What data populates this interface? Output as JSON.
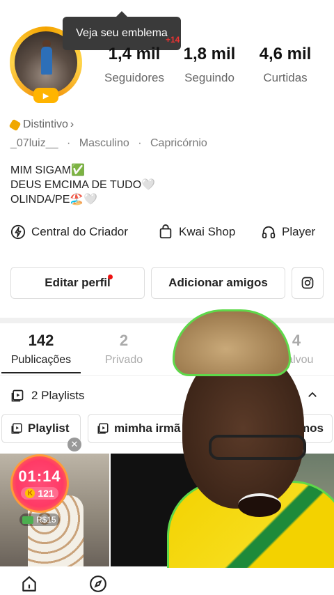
{
  "tooltip": {
    "text": "Veja seu emblema",
    "extra_badge": "+14"
  },
  "stats": [
    {
      "value": "1,4 mil",
      "label": "Seguidores"
    },
    {
      "value": "1,8 mil",
      "label": "Seguindo"
    },
    {
      "value": "4,6 mil",
      "label": "Curtidas"
    }
  ],
  "profile": {
    "distintivo": "Distintivo",
    "distintivo_chevron": "›",
    "username": "_07luiz__",
    "gender": "Masculino",
    "sign": "Capricórnio",
    "separator": "·",
    "bio_lines": [
      "MIM SIGAM✅",
      "DEUS EMCIMA DE TUDO🤍",
      "OLINDA/PE🏖️🤍"
    ]
  },
  "tools": [
    {
      "label": "Central do Criador",
      "icon": "lightning-circle-icon"
    },
    {
      "label": "Kwai Shop",
      "icon": "shopping-bag-icon"
    },
    {
      "label": "Player",
      "icon": "headphones-icon"
    }
  ],
  "actions": {
    "edit_profile": "Editar perfil",
    "add_friends": "Adicionar amigos",
    "instagram_icon": "instagram-icon"
  },
  "tabs": [
    {
      "count": "142",
      "label": "Publicações",
      "active": true
    },
    {
      "count": "2",
      "label": "Privado",
      "active": false
    },
    {
      "count": "4",
      "label": "Salvou",
      "active": false
    }
  ],
  "playlists": {
    "header": "2 Playlists",
    "chips": [
      "Playlist",
      "mimha irmã",
      "primos"
    ]
  },
  "grid": {
    "timer": "01:14",
    "coins": "121",
    "coin_symbol": "K",
    "reward": "R$15"
  },
  "colors": {
    "accent_red": "#e11111",
    "gold": "#f5a400",
    "timer_pink": "#ff3a66"
  }
}
